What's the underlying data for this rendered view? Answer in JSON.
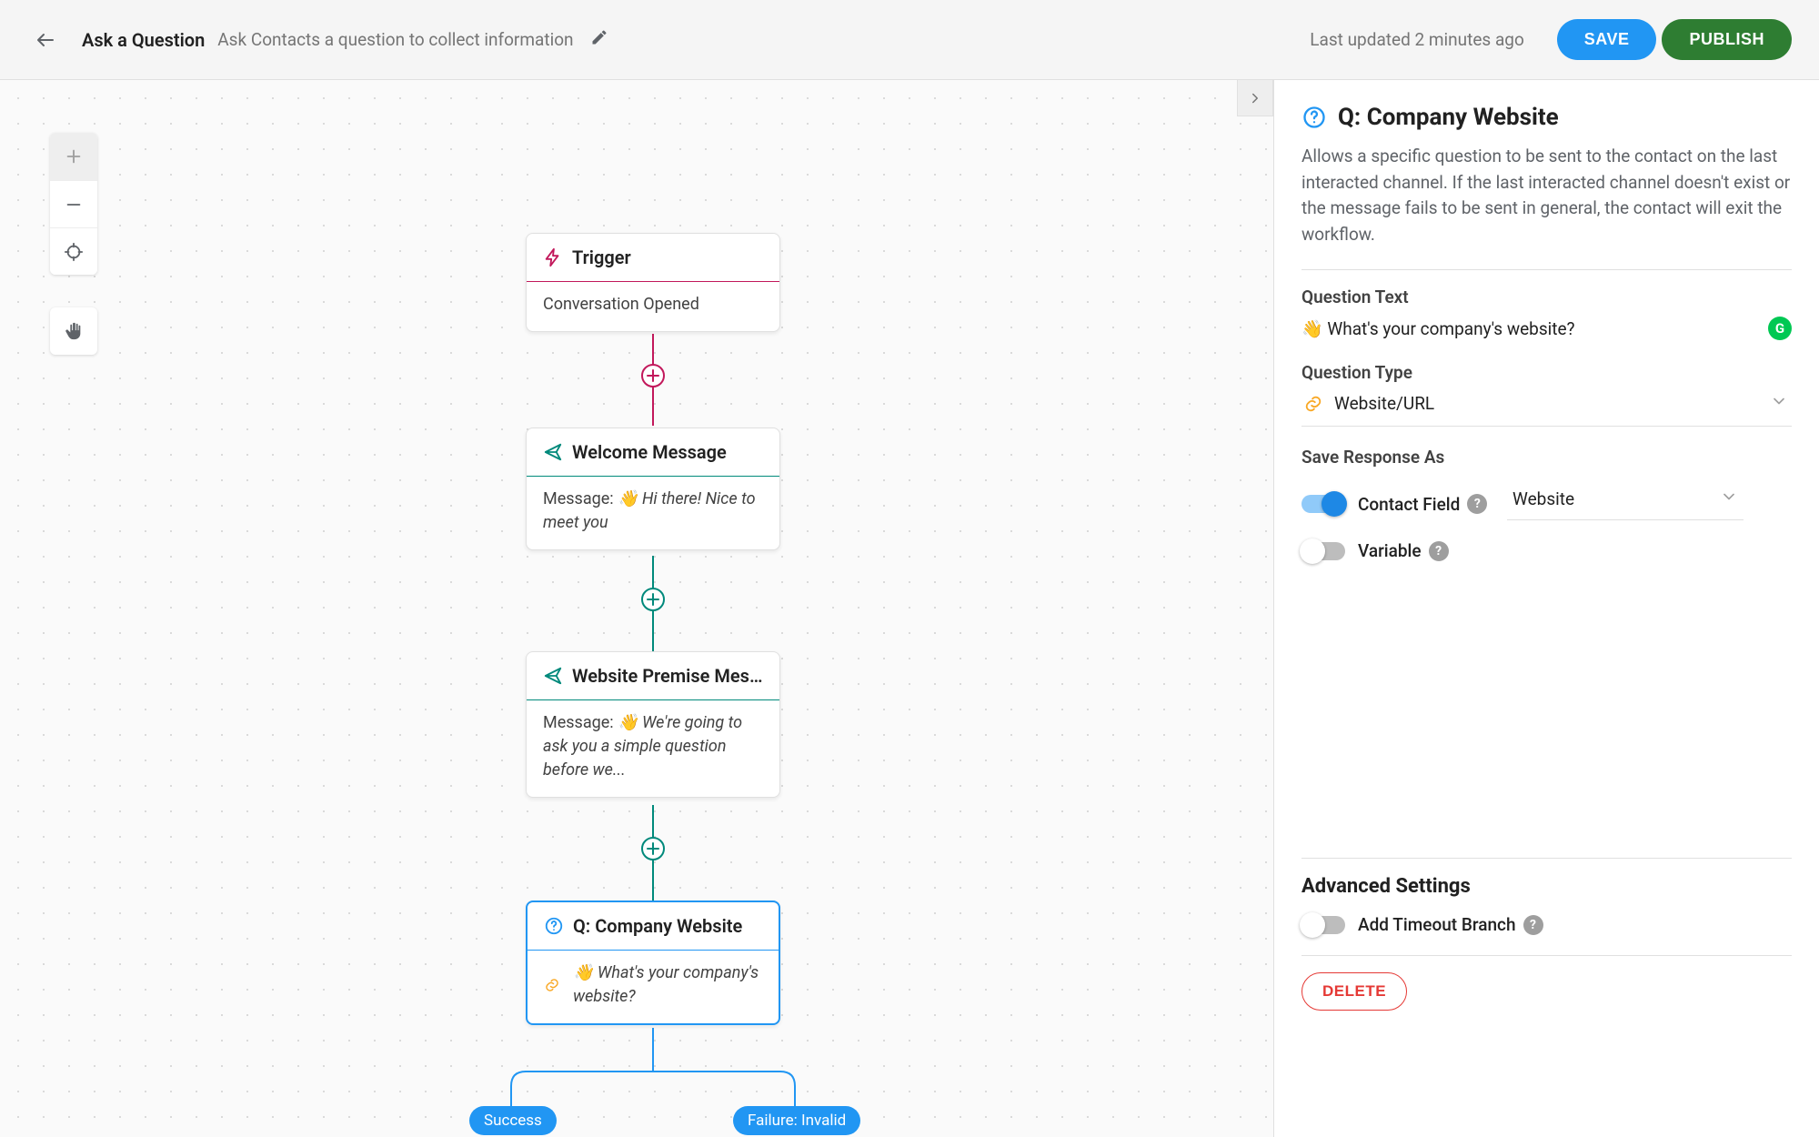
{
  "header": {
    "title": "Ask a Question",
    "subtitle": "Ask Contacts a question to collect information",
    "updated": "Last updated 2 minutes ago",
    "save": "SAVE",
    "publish": "PUBLISH"
  },
  "nodes": {
    "trigger": {
      "label": "Trigger",
      "body": "Conversation Opened"
    },
    "welcome": {
      "label": "Welcome Message",
      "prefix": "Message: ",
      "msg": "👋 Hi there! Nice to meet you"
    },
    "premise": {
      "label": "Website Premise Messa…",
      "prefix": "Message: ",
      "msg": "👋 We're going to ask you a simple question before we..."
    },
    "question": {
      "label": "Q: Company Website",
      "msg": "👋 What's your company's website?"
    }
  },
  "branches": {
    "success": "Success",
    "failure": "Failure: Invalid"
  },
  "panel": {
    "title": "Q: Company Website",
    "description": "Allows a specific question to be sent to the contact on the last interacted channel. If the last interacted channel doesn't exist or the message fails to be sent in general, the contact will exit the workflow.",
    "question_text_label": "Question Text",
    "question_text_value": "👋 What's your company's website?",
    "question_type_label": "Question Type",
    "question_type_value": "Website/URL",
    "save_response_label": "Save Response As",
    "contact_field_label": "Contact Field",
    "contact_field_value": "Website",
    "variable_label": "Variable",
    "advanced_label": "Advanced Settings",
    "timeout_label": "Add Timeout Branch",
    "delete": "DELETE"
  },
  "toggles": {
    "contact_field": true,
    "variable": false,
    "timeout": false
  }
}
